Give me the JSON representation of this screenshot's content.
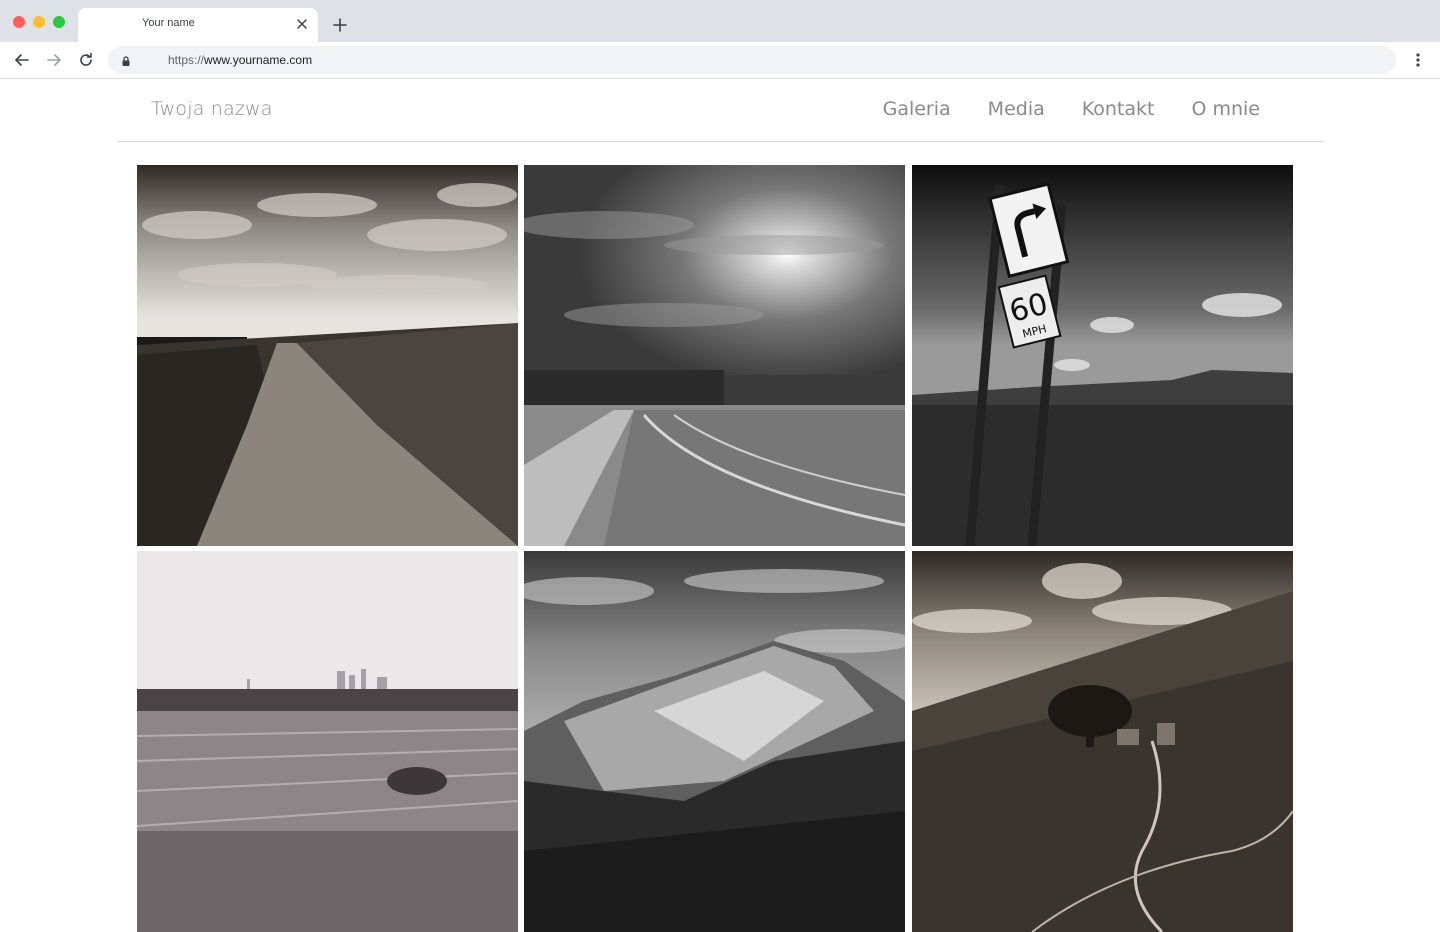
{
  "browser": {
    "tab_title": "Your name",
    "url_scheme": "https://",
    "url_host": "www.yourname.com",
    "icons": [
      "close-icon",
      "plus-icon",
      "arrow-left-icon",
      "arrow-right-icon",
      "reload-icon",
      "lock-icon",
      "kebab-menu-icon"
    ]
  },
  "site": {
    "brand": "Twoja nazwa",
    "nav": [
      "Galeria",
      "Media",
      "Kontakt",
      "O mnie"
    ]
  },
  "gallery": {
    "photos": [
      "dirt-path-under-cloudy-sky",
      "road-with-tree-line-and-sun",
      "road-sign-60-mph-desert",
      "plowed-field-with-skyline",
      "mountain-ridge-under-clouds",
      "tree-and-ruin-on-hillside"
    ],
    "sign_text": {
      "number": "60",
      "unit": "MPH"
    }
  },
  "colors": {
    "chrome_bg": "#dee1e6",
    "omnibox_bg": "#f1f3f4",
    "nav_text": "#8a8a8a",
    "divider": "#d9d9d9"
  }
}
